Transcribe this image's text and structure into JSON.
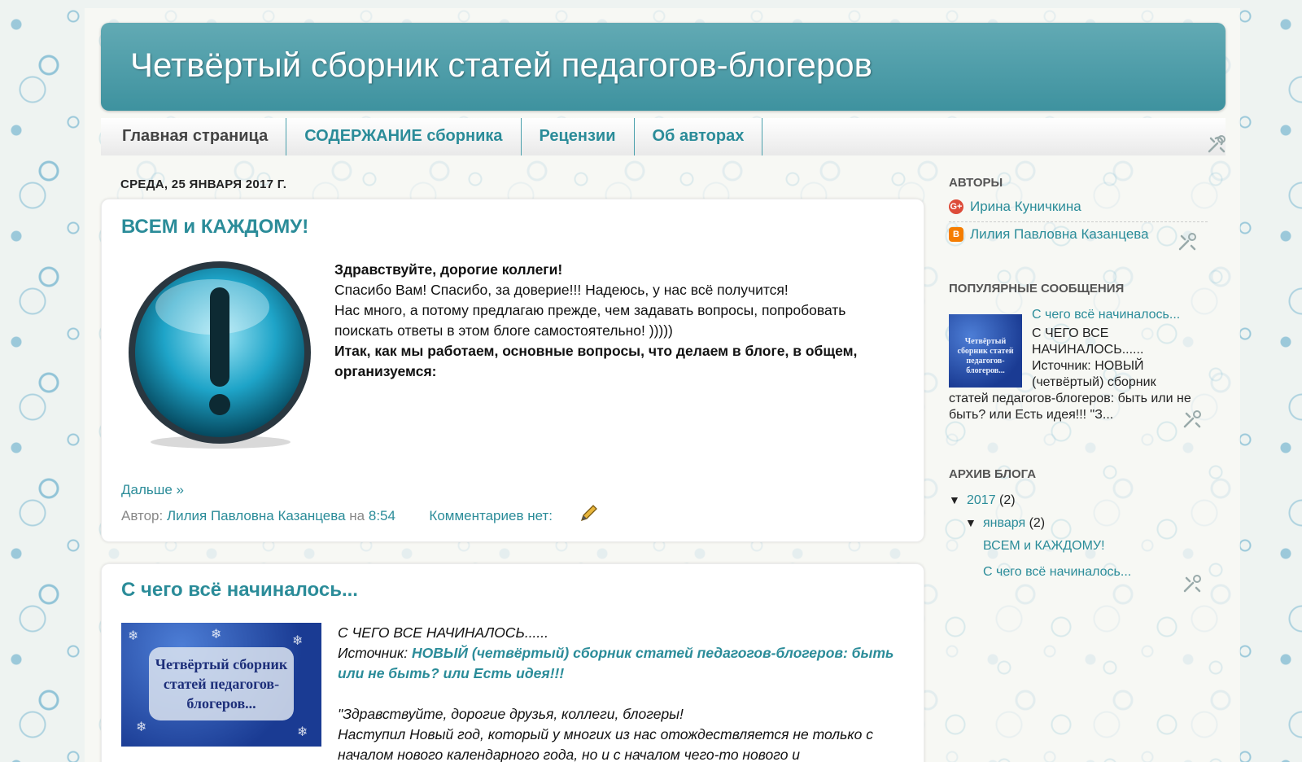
{
  "blog": {
    "title": "Четвёртый сборник статей педагогов-блогеров"
  },
  "nav": {
    "tabs": [
      {
        "label": "Главная страница"
      },
      {
        "label": "СОДЕРЖАНИЕ сборника"
      },
      {
        "label": "Рецензии"
      },
      {
        "label": "Об авторах"
      }
    ]
  },
  "posts": {
    "date_header": "СРЕДА, 25 ЯНВАРЯ 2017 Г.",
    "post1": {
      "title": "ВСЕМ и КАЖДОМУ!",
      "greeting": "Здравствуйте, дорогие коллеги!",
      "line1": "Спасибо Вам! Спасибо, за доверие!!! Надеюсь, у нас всё получится!",
      "line2": "Нас много, а потому предлагаю прежде, чем задавать вопросы, попробовать поискать ответы в этом блоге самостоятельно! )))))",
      "line3": "Итак, как мы работаем, основные вопросы, что делаем в блоге, в общем, организуемся:",
      "read_more": "Дальше »",
      "author_prefix": "Автор:",
      "author": "Лилия Павловна Казанцева",
      "at": "на",
      "time": "8:54",
      "comments": "Комментариев нет:"
    },
    "post2": {
      "title": "С чего всё начиналось...",
      "thumb_text": "Четвёртый сборник статей педагогов-блогеров...",
      "line1": "С ЧЕГО ВСЕ НАЧИНАЛОСЬ......",
      "source_prefix": "Источник:",
      "source_new": "НОВЫЙ",
      "source_rest": "(четвёртый) сборник статей педагогов-блогеров: быть или не быть? или",
      "source_end": "Есть идея!!!",
      "line3": "\"Здравствуйте, дорогие друзья, коллеги, блогеры!",
      "line4": "Наступил Новый год, который у многих из нас отождествляется не только с началом нового календарного года, но и с началом чего-то нового и"
    }
  },
  "sidebar": {
    "authors_title": "АВТОРЫ",
    "authors": [
      {
        "name": "Ирина Куничкина",
        "icon": "google-plus-icon",
        "glyph": "G+"
      },
      {
        "name": "Лилия Павловна Казанцева",
        "icon": "blogger-icon",
        "glyph": "B"
      }
    ],
    "popular_title": "ПОПУЛЯРНЫЕ СООБЩЕНИЯ",
    "popular": {
      "link": "С чего всё начиналось...",
      "thumb_text": "Четвёртый сборник статей педагогов-блогеров...",
      "snippet_a": "С ЧЕГО ВСЕ НАЧИНАЛОСЬ...... Источник: НОВЫЙ (четвёртый) сборник",
      "snippet_b": "статей педагогов-блогеров: быть или не быть? или Есть идея!!! \"З..."
    },
    "archive_title": "АРХИВ БЛОГА",
    "archive": {
      "year": "2017",
      "year_count": "(2)",
      "month": "января",
      "month_count": "(2)",
      "posts": [
        "ВСЕМ и КАЖДОМУ!",
        "С чего всё начиналось..."
      ],
      "expanded_glyph": "▼"
    }
  },
  "colors": {
    "accent": "#2b8c99",
    "header": "#4a9ca8"
  }
}
